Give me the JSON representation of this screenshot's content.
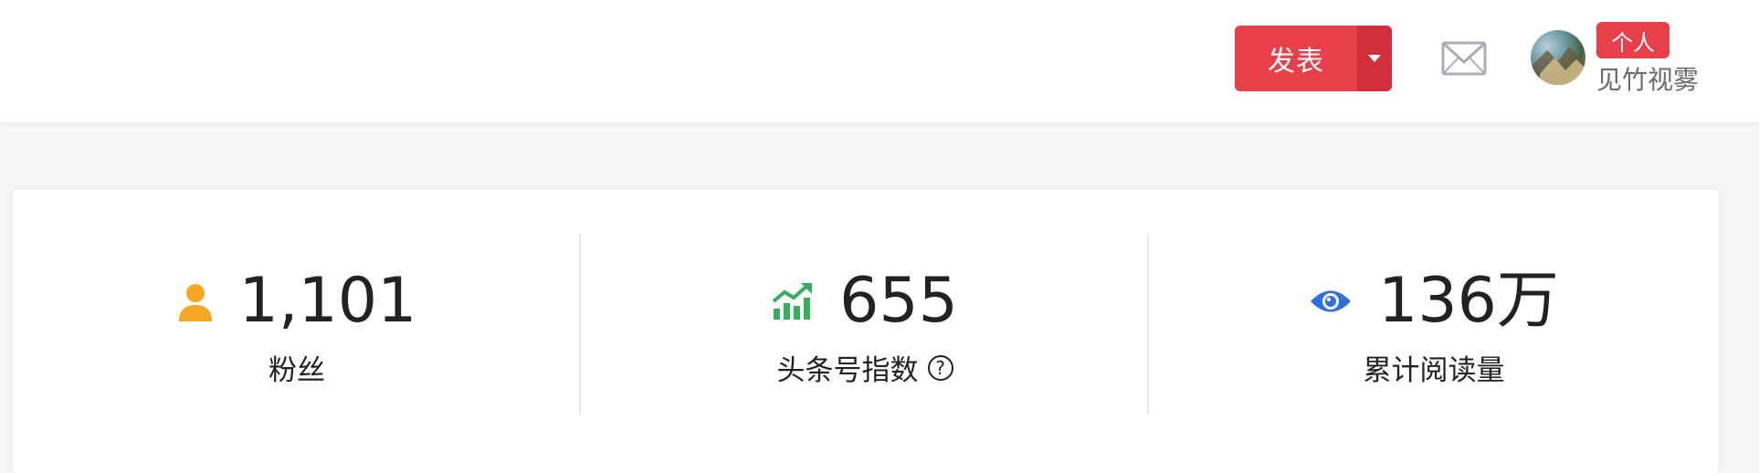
{
  "header": {
    "publish_label": "发表",
    "user": {
      "badge": "个人",
      "name": "见竹视雾"
    }
  },
  "stats": [
    {
      "value": "1,101",
      "label": "粉丝",
      "icon": "user-icon"
    },
    {
      "value": "655",
      "label": "头条号指数",
      "icon": "trend-chart-icon",
      "help": "?"
    },
    {
      "value": "136万",
      "label": "累计阅读量",
      "icon": "eye-icon"
    }
  ],
  "colors": {
    "brand_red": "#e8404a",
    "brand_red_dark": "#d12f3a",
    "user_icon": "#f5a623",
    "trend_icon": "#34b05a",
    "eye_icon": "#2f6fe0"
  }
}
